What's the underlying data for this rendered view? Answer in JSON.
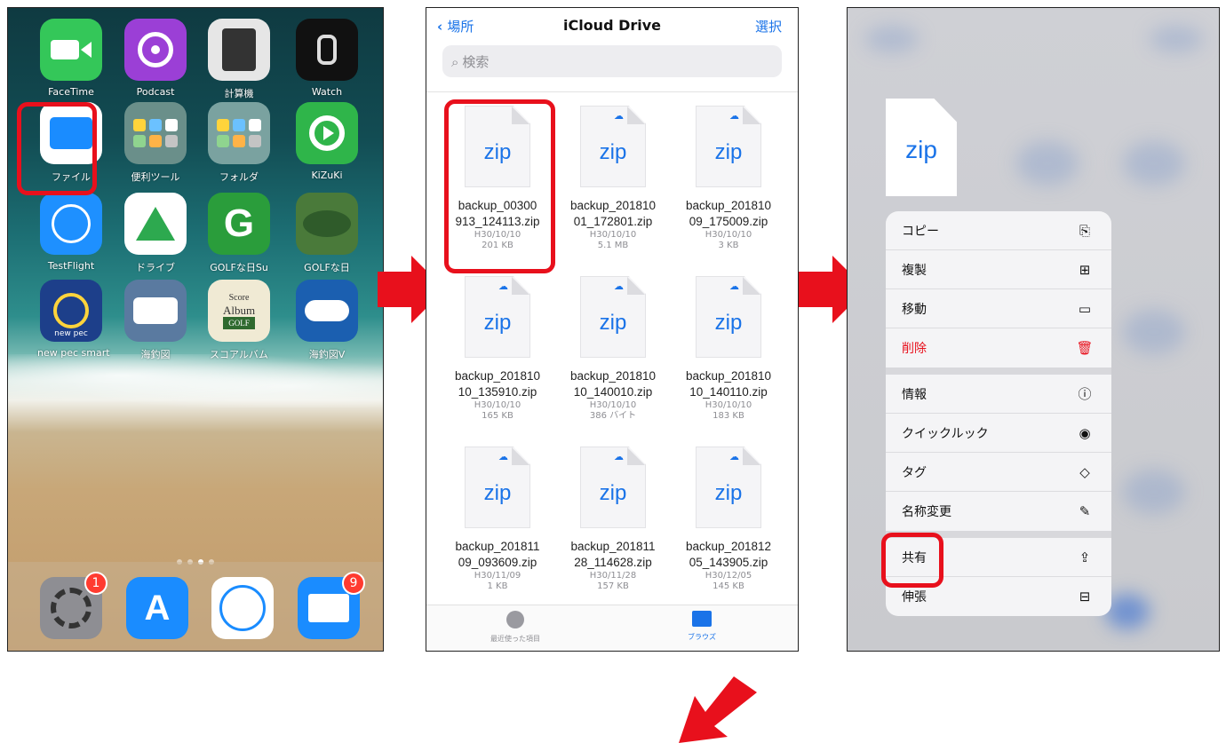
{
  "home": {
    "apps": [
      {
        "id": "facetime",
        "label": "FaceTime",
        "icon": "video-camera-icon",
        "color": "#34c759"
      },
      {
        "id": "podcast",
        "label": "Podcast",
        "icon": "podcast-icon",
        "color": "#9b3fd6"
      },
      {
        "id": "calculator",
        "label": "計算機",
        "icon": "calculator-icon",
        "color": "#e6e6e6"
      },
      {
        "id": "watch",
        "label": "Watch",
        "icon": "watch-icon",
        "color": "#111111"
      },
      {
        "id": "files",
        "label": "ファイル",
        "icon": "folder-icon",
        "color": "#1a8cff"
      },
      {
        "id": "tools",
        "label": "便利ツール",
        "icon": "app-folder-icon",
        "color": "#6a8f8a"
      },
      {
        "id": "folder",
        "label": "フォルダ",
        "icon": "app-folder-icon",
        "color": "#7aa2a0"
      },
      {
        "id": "kizuki",
        "label": "KiZuKi",
        "icon": "kizuki-icon",
        "color": "#2fb54a"
      },
      {
        "id": "testflight",
        "label": "TestFlight",
        "icon": "propeller-icon",
        "color": "#1e90ff"
      },
      {
        "id": "drive",
        "label": "ドライブ",
        "icon": "google-drive-icon",
        "color": "#ffffff"
      },
      {
        "id": "golf1",
        "label": "GOLFな日Su",
        "icon": "golf-g-icon",
        "color": "#2a9d3b"
      },
      {
        "id": "golf2",
        "label": "GOLFな日",
        "icon": "golf-course-icon",
        "color": "#4a7a3a"
      },
      {
        "id": "newpec",
        "label": "new pec smart",
        "icon": "ship-wheel-icon",
        "color": "#1d3f8a"
      },
      {
        "id": "umitsuri",
        "label": "海釣図",
        "icon": "fish-icon",
        "color": "#5a7aa0"
      },
      {
        "id": "scorealbum",
        "label": "スコアルバム",
        "icon": "score-album-icon",
        "color": "#2f6a2f"
      },
      {
        "id": "umitsuriv",
        "label": "海釣図V",
        "icon": "boat-icon",
        "color": "#1b5fb0"
      }
    ],
    "score_album_text": {
      "line1": "Score",
      "line2": "Album",
      "line3": "GOLF"
    },
    "newpec_text": "new pec",
    "dock": [
      {
        "id": "settings",
        "icon": "gear-icon",
        "badge": "1",
        "color": "#8e8e93"
      },
      {
        "id": "appstore",
        "icon": "app-store-icon",
        "badge": "",
        "color": "#1a8cff"
      },
      {
        "id": "safari",
        "icon": "compass-icon",
        "badge": "",
        "color": "#ffffff"
      },
      {
        "id": "mail",
        "icon": "envelope-icon",
        "badge": "9",
        "color": "#1a8cff"
      }
    ]
  },
  "files": {
    "back_label": "場所",
    "title": "iCloud Drive",
    "select_label": "選択",
    "search_placeholder": "検索",
    "ext": "zip",
    "items": [
      {
        "line1": "backup_00300",
        "line2": "913_124113.zip",
        "date": "H30/10/10",
        "size": "201 KB",
        "cloud": false
      },
      {
        "line1": "backup_201810",
        "line2": "01_172801.zip",
        "date": "H30/10/10",
        "size": "5.1 MB",
        "cloud": true
      },
      {
        "line1": "backup_201810",
        "line2": "09_175009.zip",
        "date": "H30/10/10",
        "size": "3 KB",
        "cloud": true
      },
      {
        "line1": "backup_201810",
        "line2": "10_135910.zip",
        "date": "H30/10/10",
        "size": "165 KB",
        "cloud": true
      },
      {
        "line1": "backup_201810",
        "line2": "10_140010.zip",
        "date": "H30/10/10",
        "size": "386 バイト",
        "cloud": true
      },
      {
        "line1": "backup_201810",
        "line2": "10_140110.zip",
        "date": "H30/10/10",
        "size": "183 KB",
        "cloud": true
      },
      {
        "line1": "backup_201811",
        "line2": "09_093609.zip",
        "date": "H30/11/09",
        "size": "1 KB",
        "cloud": true
      },
      {
        "line1": "backup_201811",
        "line2": "28_114628.zip",
        "date": "H30/11/28",
        "size": "157 KB",
        "cloud": true
      },
      {
        "line1": "backup_201812",
        "line2": "05_143905.zip",
        "date": "H30/12/05",
        "size": "145 KB",
        "cloud": true
      }
    ],
    "tabs": [
      {
        "label": "最近使った項目",
        "icon": "clock-icon",
        "active": false
      },
      {
        "label": "ブラウズ",
        "icon": "folder-icon",
        "active": true
      }
    ]
  },
  "context": {
    "ext": "zip",
    "groups": [
      [
        {
          "label": "コピー",
          "icon": "copy-icon",
          "glyph": "⎘",
          "danger": false
        },
        {
          "label": "複製",
          "icon": "duplicate-icon",
          "glyph": "⊞",
          "danger": false
        },
        {
          "label": "移動",
          "icon": "folder-icon",
          "glyph": "▭",
          "danger": false
        },
        {
          "label": "削除",
          "icon": "trash-icon",
          "glyph": "🗑",
          "danger": true
        }
      ],
      [
        {
          "label": "情報",
          "icon": "info-icon",
          "glyph": "ⓘ",
          "danger": false
        },
        {
          "label": "クイックルック",
          "icon": "eye-icon",
          "glyph": "◉",
          "danger": false
        },
        {
          "label": "タグ",
          "icon": "tag-icon",
          "glyph": "◇",
          "danger": false
        },
        {
          "label": "名称変更",
          "icon": "edit-icon",
          "glyph": "✎",
          "danger": false
        }
      ],
      [
        {
          "label": "共有",
          "icon": "share-icon",
          "glyph": "⇪",
          "danger": false
        },
        {
          "label": "伸張",
          "icon": "archive-icon",
          "glyph": "⊟",
          "danger": false
        }
      ]
    ]
  },
  "colors": {
    "highlight": "#e8101c",
    "accent": "#1a73e8"
  }
}
